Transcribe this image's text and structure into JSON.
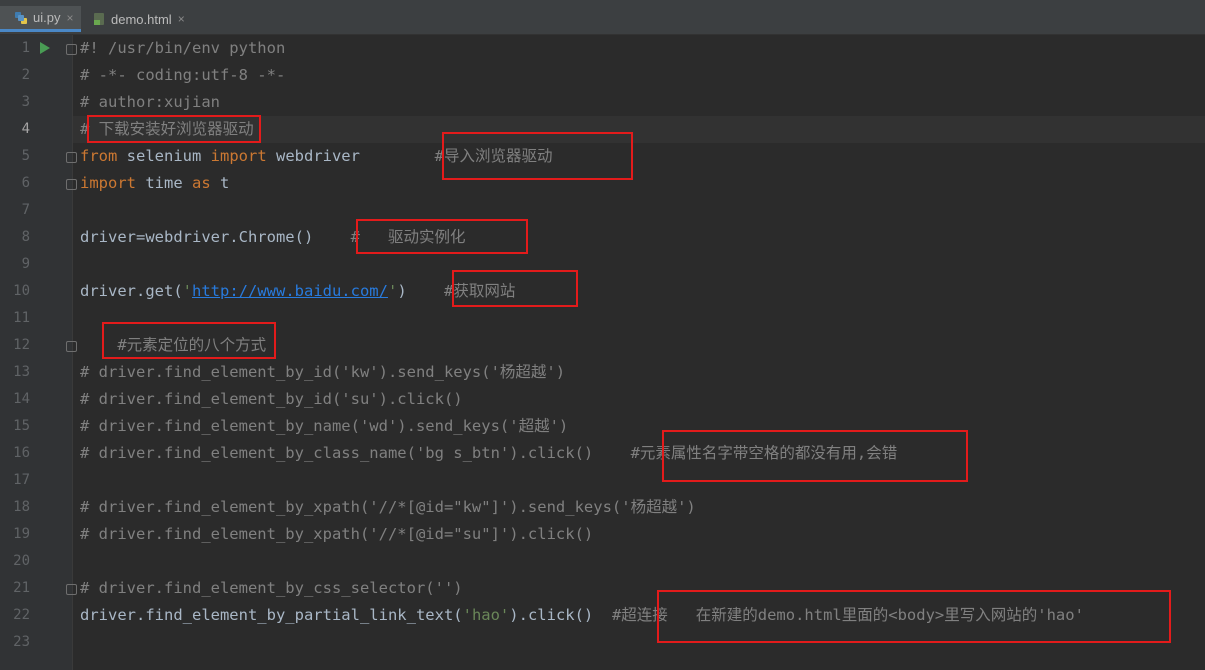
{
  "tabs": [
    {
      "label": "ui.py",
      "active": true
    },
    {
      "label": "demo.html",
      "active": false
    }
  ],
  "close_glyph": "×",
  "colors": {
    "keyword": "#cc7832",
    "comment": "#808080",
    "string": "#6a8759",
    "url": "#287bde",
    "highlight_box": "#e31b1b",
    "run_arrow": "#499c54"
  },
  "icons": [
    "python-file-icon",
    "html-file-icon",
    "run-icon",
    "fold-icon"
  ],
  "current_line": 4,
  "lines": [
    {
      "n": "1",
      "parts": [
        {
          "t": "#! /usr/bin/env python",
          "c": "cm"
        }
      ]
    },
    {
      "n": "2",
      "parts": [
        {
          "t": "# -*- coding:utf-8 -*-",
          "c": "cm"
        }
      ]
    },
    {
      "n": "3",
      "parts": [
        {
          "t": "# author:xujian",
          "c": "cm"
        }
      ]
    },
    {
      "n": "4",
      "parts": [
        {
          "t": "# 下载安装好浏览器驱动",
          "c": "cm"
        }
      ]
    },
    {
      "n": "5",
      "parts": [
        {
          "t": "from",
          "c": "kw"
        },
        {
          "t": " selenium ",
          "c": ""
        },
        {
          "t": "import",
          "c": "kw"
        },
        {
          "t": " webdriver        ",
          "c": ""
        },
        {
          "t": "#导入浏览器驱动",
          "c": "cm"
        }
      ]
    },
    {
      "n": "6",
      "parts": [
        {
          "t": "import",
          "c": "kw"
        },
        {
          "t": " time ",
          "c": ""
        },
        {
          "t": "as",
          "c": "kw"
        },
        {
          "t": " t",
          "c": ""
        }
      ]
    },
    {
      "n": "7",
      "parts": []
    },
    {
      "n": "8",
      "parts": [
        {
          "t": "driver=webdriver.Chrome()    ",
          "c": ""
        },
        {
          "t": "#   驱动实例化",
          "c": "cm"
        }
      ]
    },
    {
      "n": "9",
      "parts": []
    },
    {
      "n": "10",
      "parts": [
        {
          "t": "driver.get(",
          "c": ""
        },
        {
          "t": "'",
          "c": "str"
        },
        {
          "t": "http://www.baidu.com/",
          "c": "url"
        },
        {
          "t": "'",
          "c": "str"
        },
        {
          "t": ")    ",
          "c": ""
        },
        {
          "t": "#获取网站",
          "c": "cm"
        }
      ]
    },
    {
      "n": "11",
      "parts": []
    },
    {
      "n": "12",
      "parts": [
        {
          "t": "    #元素定位的八个方式",
          "c": "cm"
        }
      ]
    },
    {
      "n": "13",
      "parts": [
        {
          "t": "# driver.find_element_by_id('kw').send_keys('杨超越')",
          "c": "cm"
        }
      ]
    },
    {
      "n": "14",
      "parts": [
        {
          "t": "# driver.find_element_by_id('su').click()",
          "c": "cm"
        }
      ]
    },
    {
      "n": "15",
      "parts": [
        {
          "t": "# driver.find_element_by_name('wd').send_keys('超越')",
          "c": "cm"
        }
      ]
    },
    {
      "n": "16",
      "parts": [
        {
          "t": "# driver.find_element_by_class_name('bg s_btn').click()    #元素属性名字带空格的都没有用,会错",
          "c": "cm"
        }
      ]
    },
    {
      "n": "17",
      "parts": []
    },
    {
      "n": "18",
      "parts": [
        {
          "t": "# driver.find_element_by_xpath('//*[@id=\"kw\"]').send_keys('杨超越')",
          "c": "cm"
        }
      ]
    },
    {
      "n": "19",
      "parts": [
        {
          "t": "# driver.find_element_by_xpath('//*[@id=\"su\"]').click()",
          "c": "cm"
        }
      ]
    },
    {
      "n": "20",
      "parts": []
    },
    {
      "n": "21",
      "parts": [
        {
          "t": "# driver.find_element_by_css_selector('')",
          "c": "cm"
        }
      ]
    },
    {
      "n": "22",
      "parts": [
        {
          "t": "driver.find_element_by_partial_link_text(",
          "c": ""
        },
        {
          "t": "'hao'",
          "c": "str"
        },
        {
          "t": ").click()  ",
          "c": ""
        },
        {
          "t": "#超连接   在新建的demo.html里面的<body>里写入网站的'hao'",
          "c": "cm"
        }
      ]
    },
    {
      "n": "23",
      "parts": []
    }
  ]
}
